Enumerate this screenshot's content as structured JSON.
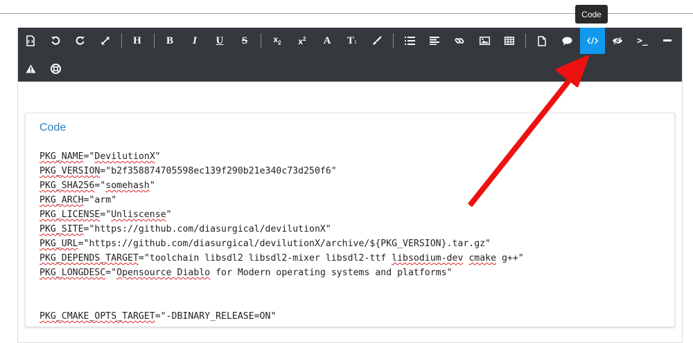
{
  "tooltip": "Code",
  "toolbar": {
    "row1": [
      "source-icon",
      "undo-icon",
      "redo-icon",
      "fullscreen-icon",
      "heading",
      "bold",
      "italic",
      "underline",
      "strikethrough",
      "subscript",
      "superscript",
      "font-color",
      "font-size",
      "brush-icon",
      "unordered-list-icon",
      "align-icon",
      "link-icon",
      "image-icon",
      "table-icon",
      "page-icon",
      "comment-icon",
      "code-icon",
      "preview-icon",
      "terminal-icon",
      "horizontal-rule-icon"
    ],
    "row2": [
      "warning-icon",
      "help-icon"
    ],
    "labels": {
      "heading": "H",
      "bold": "B",
      "italic": "I",
      "underline": "U",
      "strike": "S",
      "subscript_base": "x",
      "subscript_sub": "2",
      "superscript_base": "x",
      "superscript_sup": "2",
      "font_color": "A",
      "font_size": "T",
      "terminal": ">_"
    }
  },
  "card": {
    "title": "Code",
    "lines": [
      {
        "pre": "",
        "key": "PKG_NAME",
        "mid": "=\"",
        "val": "DevilutionX",
        "post": "\""
      },
      {
        "pre": "",
        "key": "PKG_VERSION",
        "mid": "=\"b2f358874705598ec139f290b21e340c73d250f6\"",
        "val": "",
        "post": ""
      },
      {
        "pre": "",
        "key": "PKG_SHA256",
        "mid": "=\"",
        "val": "somehash",
        "post": "\""
      },
      {
        "pre": "",
        "key": "PKG_ARCH",
        "mid": "=\"arm\"",
        "val": "",
        "post": ""
      },
      {
        "pre": "",
        "key": "PKG_LICENSE",
        "mid": "=\"",
        "val": "Unliscense",
        "post": "\""
      },
      {
        "pre": "",
        "key": "PKG_SITE",
        "mid": "=\"https://github.com/diasurgical/devilutionX\"",
        "val": "",
        "post": ""
      },
      {
        "pre": "",
        "key": "PKG_URL",
        "mid": "=\"https://github.com/diasurgical/devilutionX/archive/${PKG_VERSION}.tar.gz\"",
        "val": "",
        "post": ""
      },
      {
        "pre": "",
        "key": "PKG_DEPENDS_TARGET",
        "mid": "=\"toolchain libsdl2 libsdl2-mixer libsdl2-ttf ",
        "val": "libsodium-dev",
        "post": " ",
        "val2": "cmake",
        "post2": " g++\""
      },
      {
        "pre": "",
        "key": "PKG_LONGDESC",
        "mid": "=\"",
        "val": "Opensource Diablo",
        "post": " for Modern operating systems and platforms\""
      },
      {
        "pre": "",
        "key": "",
        "mid": "",
        "val": "",
        "post": ""
      },
      {
        "pre": "",
        "key": "",
        "mid": "",
        "val": "",
        "post": ""
      },
      {
        "pre": "",
        "key": "PKG_CMAKE_OPTS_TARGET",
        "mid": "=\"-DBINARY_RELEASE=ON\"",
        "val": "",
        "post": ""
      }
    ]
  },
  "colors": {
    "toolbar_bg": "#35383c",
    "active_button": "#1199ee",
    "title_blue": "#2d7fc1",
    "annotation_arrow": "#ee1111"
  }
}
